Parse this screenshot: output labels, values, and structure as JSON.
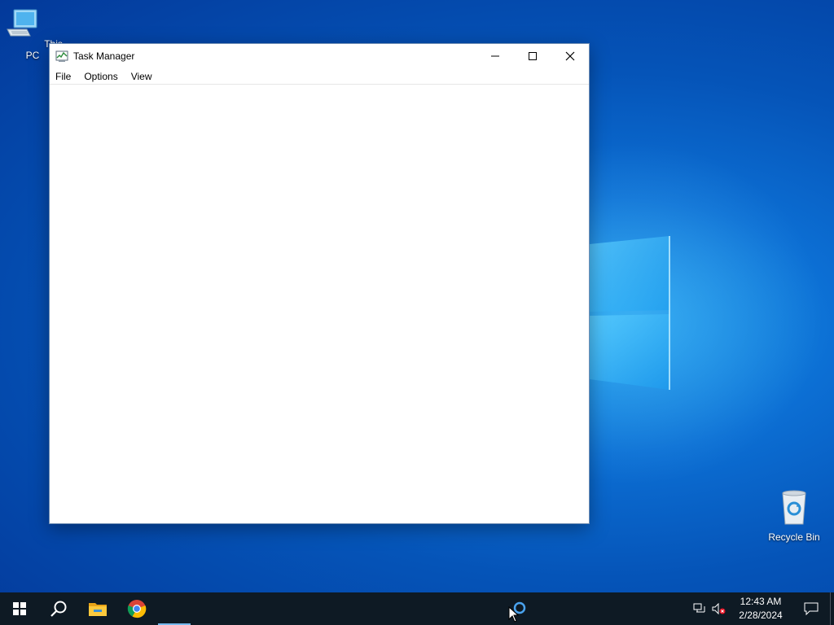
{
  "desktop": {
    "icons": [
      {
        "label": "This PC",
        "icon": "computer-icon"
      },
      {
        "label": "Recycle Bin",
        "icon": "recycle-bin-icon"
      }
    ]
  },
  "window": {
    "title": "Task Manager",
    "icon": "task-manager-icon",
    "controls": {
      "minimize": "minimize-icon",
      "maximize": "maximize-icon",
      "close": "close-icon"
    },
    "menu": [
      "File",
      "Options",
      "View"
    ]
  },
  "taskbar": {
    "apps": [
      {
        "name": "start",
        "icon": "windows-icon"
      },
      {
        "name": "search",
        "icon": "search-icon"
      },
      {
        "name": "file-explorer",
        "icon": "folder-icon"
      },
      {
        "name": "chrome",
        "icon": "chrome-icon"
      }
    ],
    "tray": {
      "time": "12:43 AM",
      "date": "2/28/2024",
      "icons": [
        "network-icon",
        "volume-muted-icon",
        "notification-icon"
      ]
    }
  },
  "colors": {
    "taskbar": "#0e1a24",
    "accent": "#76b9ed",
    "desktop": "#0554b8"
  }
}
